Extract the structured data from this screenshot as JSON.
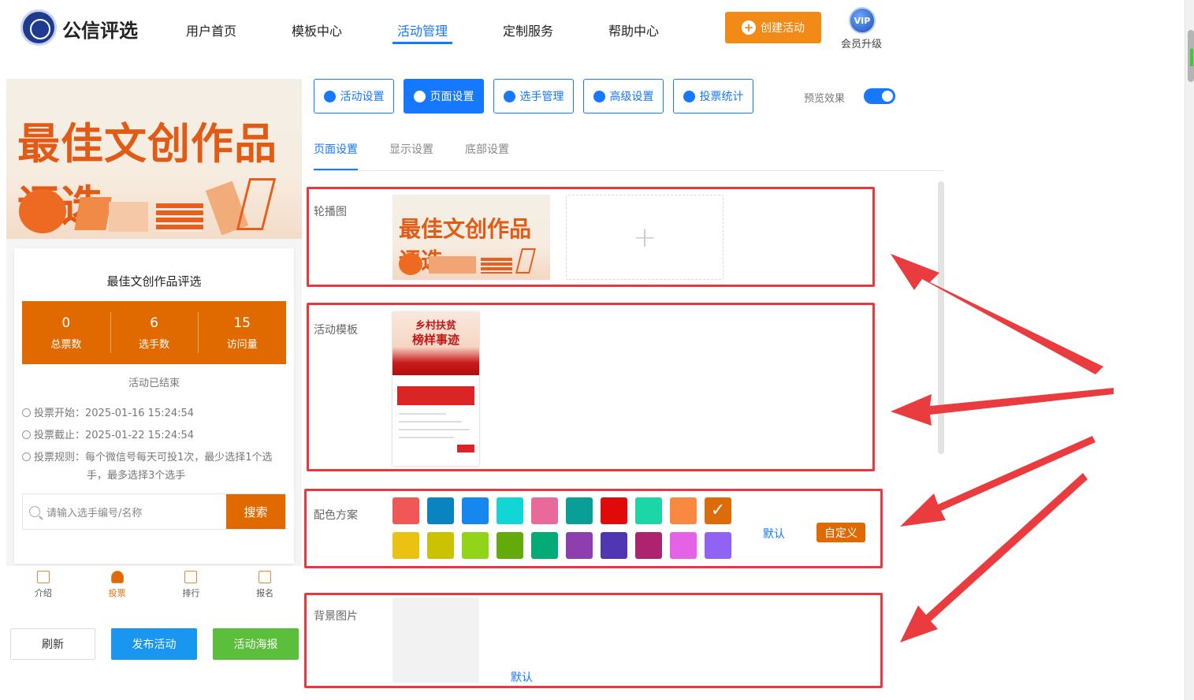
{
  "header": {
    "brand": "公信评选",
    "nav": [
      "用户首页",
      "模板中心",
      "活动管理",
      "定制服务",
      "帮助中心"
    ],
    "active_nav": "活动管理",
    "create_button": "创建活动",
    "vip_badge": "VIP",
    "vip_label": "会员升级"
  },
  "preview": {
    "banner_title": "最佳文创作品评选",
    "activity_title": "最佳文创作品评选",
    "stats": [
      {
        "value": "0",
        "label": "总票数"
      },
      {
        "value": "6",
        "label": "选手数"
      },
      {
        "value": "15",
        "label": "访问量"
      }
    ],
    "status": "活动已结束",
    "vote_start": "投票开始：2025-01-16 15:24:54",
    "vote_end": "投票截止：2025-01-22 15:24:54",
    "vote_rule_line1": "投票规则：每个微信号每天可投1次，最少选择1个选",
    "vote_rule_line2": "手，最多选择3个选手",
    "search_placeholder": "请输入选手编号/名称",
    "search_button": "搜索",
    "tabs": [
      "介绍",
      "投票",
      "排行",
      "报名"
    ],
    "active_tab": "投票"
  },
  "actions": {
    "refresh": "刷新",
    "publish": "发布活动",
    "poster": "活动海报"
  },
  "settings": {
    "buttons": [
      "活动设置",
      "页面设置",
      "选手管理",
      "高级设置",
      "投票统计"
    ],
    "active_button": "页面设置",
    "preview_label": "预览效果",
    "preview_on": true,
    "subtabs": [
      "页面设置",
      "显示设置",
      "底部设置"
    ],
    "active_subtab": "页面设置",
    "carousel_label": "轮播图",
    "carousel_image_title": "最佳文创作品评选",
    "template_label": "活动模板",
    "template_title_1": "乡村扶贫",
    "template_title_2": "榜样事迹",
    "color_label": "配色方案",
    "colors_row1": [
      "#f25757",
      "#0a84c1",
      "#1787f0",
      "#12d6d6",
      "#e96a9a",
      "#0a9f96",
      "#e00a0a",
      "#1dd6a7",
      "#f98840",
      "#de6b0a"
    ],
    "colors_row2": [
      "#ecc212",
      "#cbc204",
      "#92d417",
      "#64aa0a",
      "#04ab77",
      "#8e3eaf",
      "#5136b3",
      "#ad236f",
      "#e562e6",
      "#9063f5"
    ],
    "selected_color": "#de6b0a",
    "default_link": "默认",
    "custom_button": "自定义",
    "background_label": "背景图片",
    "background_default": "默认"
  }
}
